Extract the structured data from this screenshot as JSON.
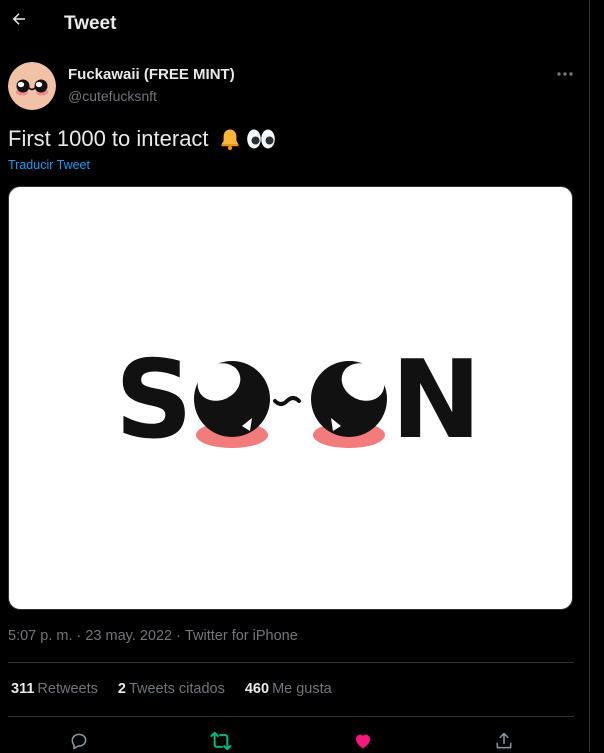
{
  "header": {
    "title": "Tweet",
    "back_icon": "arrow-left-icon"
  },
  "author": {
    "display_name": "Fuckawaii (FREE MINT)",
    "handle": "@cutefucksnft"
  },
  "tweet": {
    "text": "First 1000 to interact",
    "emojis": [
      "bell-emoji",
      "eyes-emoji"
    ],
    "translate_label": "Traducir Tweet",
    "media": {
      "wordmark": "SO~ON"
    }
  },
  "meta": {
    "time": "5:07 p. m.",
    "separator": "·",
    "date": "23 may. 2022",
    "client": "Twitter for iPhone"
  },
  "stats": {
    "retweets": {
      "count": "311",
      "label": "Retweets"
    },
    "quotes": {
      "count": "2",
      "label": "Tweets citados"
    },
    "likes": {
      "count": "460",
      "label": "Me gusta"
    }
  },
  "actions": [
    "reply-icon",
    "retweet-icon",
    "like-icon",
    "share-icon"
  ],
  "colors": {
    "background": "#000000",
    "link": "#1d9bf0",
    "retweet": "#00ba7c",
    "like": "#f91880",
    "muted": "#71767b"
  }
}
